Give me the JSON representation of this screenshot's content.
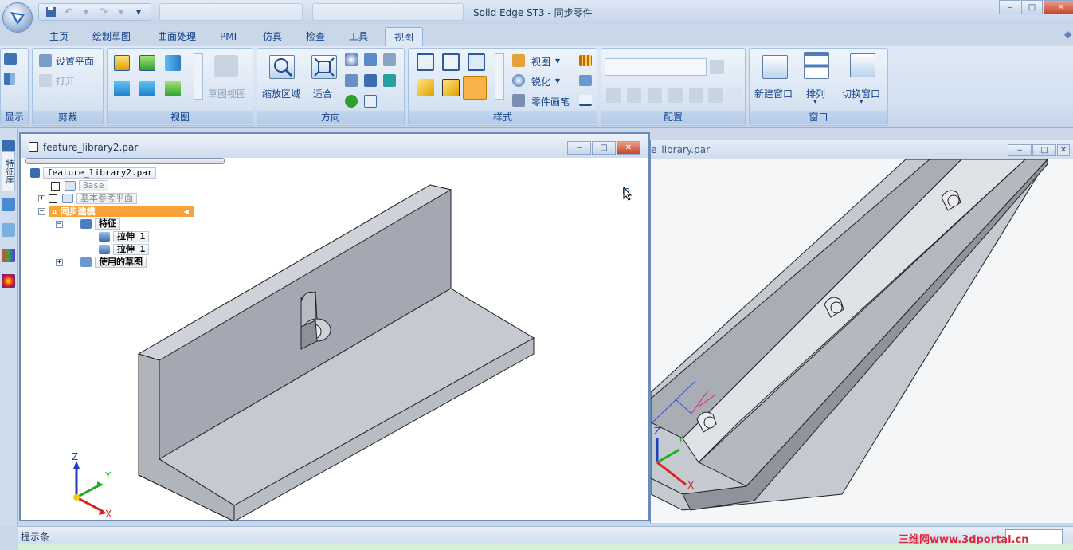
{
  "app": {
    "title": "Solid Edge ST3 - 同步零件"
  },
  "window_controls": {
    "minimize": "‒",
    "maximize": "□",
    "close": "✕"
  },
  "tabs": [
    {
      "label": "主页"
    },
    {
      "label": "绘制草图"
    },
    {
      "label": "曲面处理"
    },
    {
      "label": "PMI"
    },
    {
      "label": "仿真"
    },
    {
      "label": "检查"
    },
    {
      "label": "工具"
    },
    {
      "label": "视图",
      "active": true
    }
  ],
  "ribbon": {
    "groups": {
      "display": "显示",
      "clip": "剪裁",
      "view": "视图",
      "orient": "方向",
      "style": "样式",
      "config": "配置",
      "window": "窗口"
    },
    "clip": {
      "set_plane": "设置平面",
      "open": "打开"
    },
    "view_group": {
      "sketch_view": "草图视图"
    },
    "orient_group": {
      "zoom_area": "缩放区域",
      "fit": "适合"
    },
    "style_group": {
      "view": "视图",
      "sharpen": "锐化",
      "part_painter": "零件画笔"
    },
    "window_group": {
      "new_window": "新建窗口",
      "arrange": "排列",
      "switch_window": "切换窗口"
    }
  },
  "doc_window_main": {
    "title": "feature_library2.par"
  },
  "doc_window_second": {
    "title": "e_library.par"
  },
  "pathfinder": {
    "root": "feature_library2.par",
    "items": [
      {
        "label": "Base"
      },
      {
        "label": "基本参考平面"
      },
      {
        "label": "同步建模"
      },
      {
        "label": "特征"
      },
      {
        "label": "拉伸 1"
      },
      {
        "label": "拉伸 1"
      },
      {
        "label": "使用的草图"
      }
    ]
  },
  "left_toolbar": {
    "pathfinder_tab": "特征库"
  },
  "axes": {
    "z": "Z",
    "y": "Y",
    "x": "X"
  },
  "statusbar": {
    "prompt": "提示条"
  },
  "watermark": "三维网www.3dportal.cn",
  "colors": {
    "ribbon_bg": "#dfe9f5",
    "highlight": "#f7a33a",
    "axis_z": "#1f3fbf",
    "axis_y": "#22b022",
    "axis_x": "#e02020"
  }
}
